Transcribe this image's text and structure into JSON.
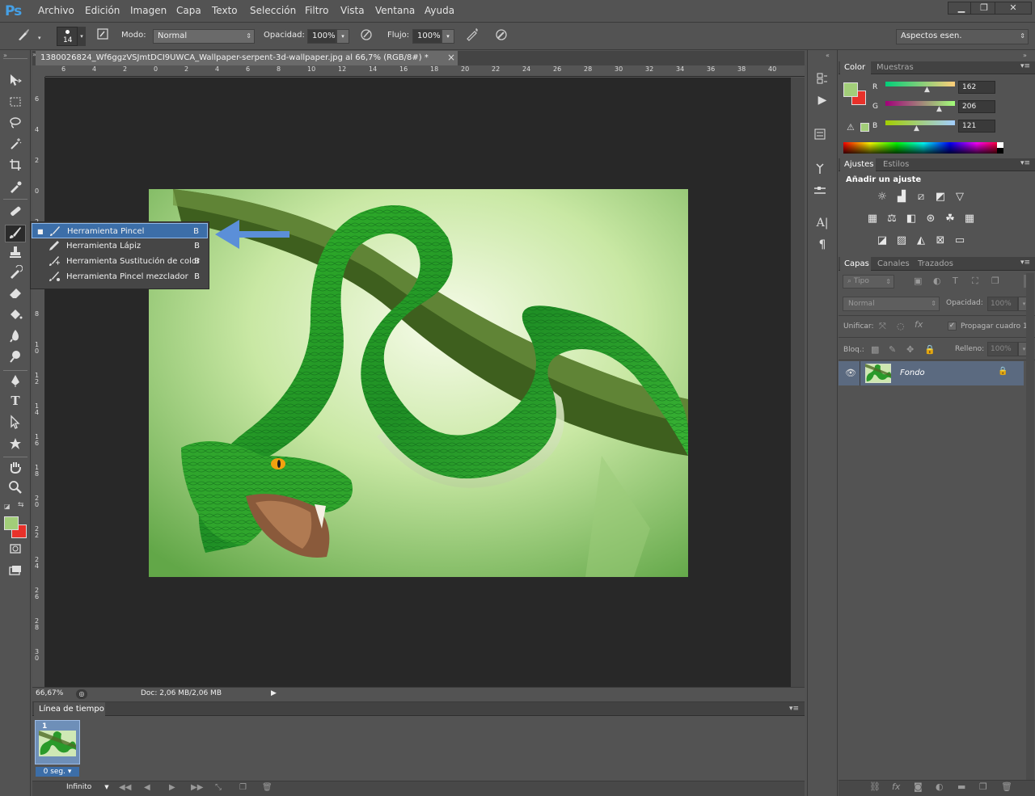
{
  "app": {
    "logo": "Ps"
  },
  "menu": [
    "Archivo",
    "Edición",
    "Imagen",
    "Capa",
    "Texto",
    "Selección",
    "Filtro",
    "Vista",
    "Ventana",
    "Ayuda"
  ],
  "window_controls": {
    "minimize": "▁",
    "maximize": "❐",
    "close": "✕"
  },
  "options_bar": {
    "brush_size": "14",
    "mode_label": "Modo:",
    "mode_value": "Normal",
    "opacity_label": "Opacidad:",
    "opacity_value": "100%",
    "flow_label": "Flujo:",
    "flow_value": "100%",
    "workspace": "Aspectos esen."
  },
  "document": {
    "tab_title": "1380026824_Wf6ggzVSJmtDCI9UWCA_Wallpaper-serpent-3d-wallpaper.jpg al 66,7% (RGB/8#) *",
    "tab_close": "×",
    "hruler": [
      "6",
      "4",
      "2",
      "0",
      "2",
      "4",
      "6",
      "8",
      "10",
      "12",
      "14",
      "16",
      "18",
      "20",
      "22",
      "24",
      "26",
      "28",
      "30",
      "32",
      "34",
      "36",
      "38",
      "40"
    ],
    "vruler": [
      "6",
      "4",
      "2",
      "0",
      "2",
      "4",
      "6",
      "8",
      "10",
      "12",
      "14",
      "16",
      "18",
      "20",
      "22",
      "24",
      "26",
      "28",
      "30"
    ],
    "zoom": "66,67%",
    "doc_size": "Doc: 2,06 MB/2,06 MB"
  },
  "flyout": [
    {
      "label": "Herramienta Pincel",
      "key": "B",
      "icon": "brush-icon",
      "selected": true
    },
    {
      "label": "Herramienta Lápiz",
      "key": "B",
      "icon": "pencil-icon",
      "selected": false
    },
    {
      "label": "Herramienta Sustitución de color",
      "key": "B",
      "icon": "color-replace-icon",
      "selected": false
    },
    {
      "label": "Herramienta Pincel mezclador",
      "key": "B",
      "icon": "mixer-brush-icon",
      "selected": false
    }
  ],
  "colors": {
    "foreground": "#a2ce79",
    "background": "#e8312a",
    "arrow": "#5b8fd8",
    "selection": "#3c6ea8"
  },
  "color_panel": {
    "tabs": [
      "Color",
      "Muestras"
    ],
    "channels": [
      {
        "label": "R",
        "value": "162"
      },
      {
        "label": "G",
        "value": "206"
      },
      {
        "label": "B",
        "value": "121"
      }
    ]
  },
  "adjust_panel": {
    "tabs": [
      "Ajustes",
      "Estilos"
    ],
    "title": "Añadir un ajuste"
  },
  "layers_panel": {
    "tabs": [
      "Capas",
      "Canales",
      "Trazados"
    ],
    "filter": "Tipo",
    "blend_mode": "Normal",
    "opacity_label": "Opacidad:",
    "opacity_value": "100%",
    "unify_label": "Unificar:",
    "propagate_label": "Propagar cuadro 1",
    "lock_label": "Bloq.:",
    "fill_label": "Relleno:",
    "fill_value": "100%",
    "layer_name": "Fondo"
  },
  "timeline": {
    "title": "Línea de tiempo",
    "frame_number": "1",
    "frame_delay": "0 seg.",
    "loop": "Infinito"
  }
}
